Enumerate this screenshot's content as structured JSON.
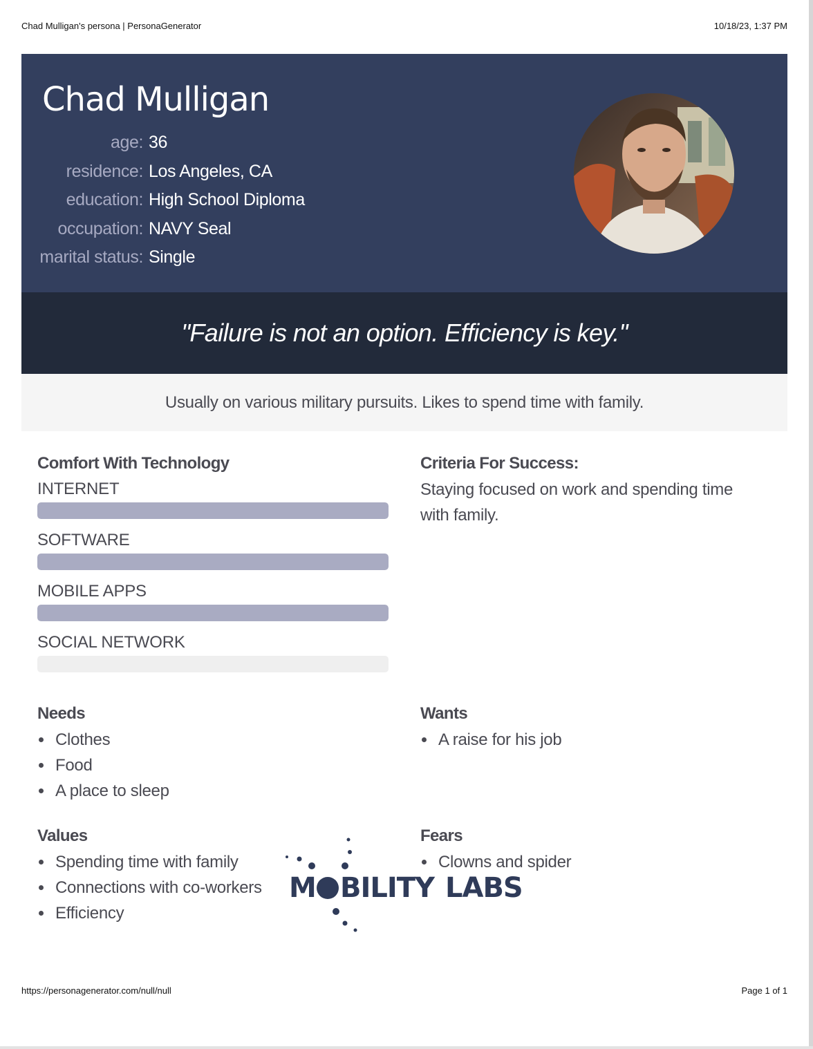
{
  "print_header": {
    "title": "Chad Mulligan's persona | PersonaGenerator",
    "datetime": "10/18/23, 1:37 PM"
  },
  "print_footer": {
    "url": "https://personagenerator.com/null/null",
    "page": "Page 1 of 1"
  },
  "persona": {
    "name": "Chad Mulligan",
    "facts": [
      {
        "label": "age:",
        "value": "36"
      },
      {
        "label": "residence:",
        "value": "Los Angeles, CA"
      },
      {
        "label": "education:",
        "value": "High School Diploma"
      },
      {
        "label": "occupation:",
        "value": "NAVY Seal"
      },
      {
        "label": "marital status:",
        "value": "Single"
      }
    ],
    "quote": "\"Failure is not an option. Efficiency is key.\"",
    "bio": "Usually on various military pursuits. Likes to spend time with family."
  },
  "technology": {
    "title": "Comfort With Technology",
    "items": [
      {
        "label": "INTERNET",
        "level": 1.0
      },
      {
        "label": "SOFTWARE",
        "level": 1.0
      },
      {
        "label": "MOBILE APPS",
        "level": 1.0
      },
      {
        "label": "SOCIAL NETWORK",
        "level": 0.0
      }
    ]
  },
  "criteria": {
    "title": "Criteria For Success:",
    "text": "Staying focused on work and spending time with family."
  },
  "needs": {
    "title": "Needs",
    "items": [
      "Clothes",
      "Food",
      "A place to sleep"
    ]
  },
  "wants": {
    "title": "Wants",
    "items": [
      "A raise for his job"
    ]
  },
  "values": {
    "title": "Values",
    "items": [
      "Spending time with family",
      "Connections with co-workers",
      "Efficiency"
    ]
  },
  "fears": {
    "title": "Fears",
    "items": [
      "Clowns and spider"
    ]
  },
  "logo": {
    "text": "MOBILITY LABS"
  },
  "colors": {
    "hero_bg": "#333f5e",
    "quote_bg": "#222a3a",
    "bar_fill": "#a9abc2",
    "bar_track": "#efefef"
  }
}
